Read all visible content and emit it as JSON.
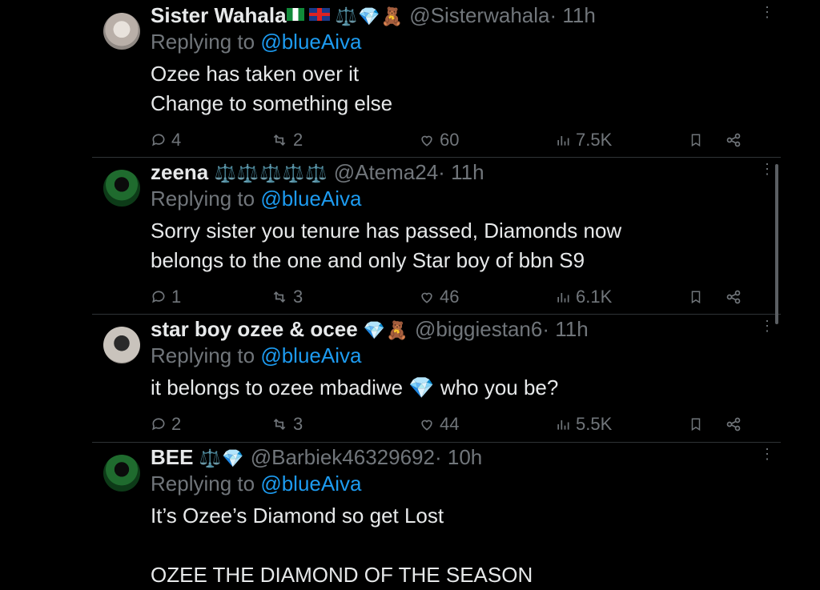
{
  "tweets": [
    {
      "name": "Sister Wahala",
      "badges": "⚖️",
      "diamond": "💎",
      "extra": "🧸",
      "handle": "@Sisterwahala",
      "dot": "·",
      "time": "11h",
      "replying_prefix": "Replying to ",
      "replying_to": "@blueAiva",
      "text_lines": [
        "Ozee has taken over it",
        "Change to something else"
      ],
      "replies": "4",
      "retweets": "2",
      "likes": "60",
      "views": "7.5K"
    },
    {
      "name": "zeena",
      "badges": "⚖️⚖️⚖️⚖️⚖️",
      "handle": "@Atema24",
      "dot": "·",
      "time": "11h",
      "replying_prefix": "Replying to ",
      "replying_to": "@blueAiva",
      "text_lines": [
        "Sorry sister you tenure has passed, Diamonds now",
        "belongs to the one and  only Star boy of bbn S9"
      ],
      "replies": "1",
      "retweets": "3",
      "likes": "46",
      "views": "6.1K"
    },
    {
      "name": "star boy ozee & ocee",
      "diamond": "💎",
      "extra": "🧸",
      "handle": "@biggiestan6",
      "dot": "·",
      "time": "11h",
      "replying_prefix": "Replying to ",
      "replying_to": "@blueAiva",
      "text_before": "it belongs to ozee mbadiwe ",
      "text_diamond": "💎",
      "text_after": " who you be?",
      "replies": "2",
      "retweets": "3",
      "likes": "44",
      "views": "5.5K"
    },
    {
      "name": "BEE",
      "badges": "⚖️",
      "diamond": "💎",
      "handle": "@Barbiek46329692",
      "dot": "·",
      "time": "10h",
      "replying_prefix": "Replying to ",
      "replying_to": "@blueAiva",
      "text_lines": [
        "It’s Ozee’s Diamond so get Lost",
        "",
        "OZEE THE DIAMOND OF THE SEASON"
      ]
    }
  ],
  "icons": {
    "more": "more-vertical-icon",
    "reply": "reply-icon",
    "retweet": "retweet-icon",
    "like": "heart-icon",
    "views": "views-icon",
    "bookmark": "bookmark-icon",
    "share": "share-icon"
  },
  "colors": {
    "background": "#000000",
    "text": "#e7e9ea",
    "muted": "#71767b",
    "link": "#1d9bf0"
  }
}
